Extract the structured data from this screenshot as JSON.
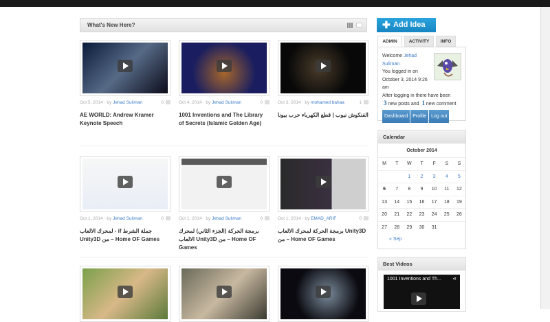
{
  "header": {
    "title": "What's New Here?"
  },
  "posts": [
    {
      "date": "Oct 5, 2014",
      "by": "by",
      "author": "Jehad Suliman",
      "comments": "0",
      "title": "AE WORLD: Andrew Kramer Keynote Speech",
      "bg": "linear-gradient(135deg,#0a1a3a,#566a86 50%,#0b0b1a)"
    },
    {
      "date": "Oct 4, 2014",
      "by": "by",
      "author": "Jehad Suliman",
      "comments": "0",
      "title": "1001 Inventions and The Library of Secrets (Islamic Golden Age)",
      "bg": "radial-gradient(circle at 50% 60%,#a7662a,#1a1e60 60%)"
    },
    {
      "date": "Oct 3, 2014",
      "by": "by",
      "author": "mohamed bahaa",
      "comments": "1",
      "title": "الفنكوش نيوب | قطع الكهرباء حرب بيونا",
      "bg": "radial-gradient(circle at 45% 50%,#4a3c2a,#080808 60%)"
    },
    {
      "date": "Oct 1, 2014",
      "by": "by",
      "author": "Jehad Suliman",
      "comments": "0",
      "title": "لمحرك الالعاب - if جملة الشرط Unity3D من – Home OF Games",
      "bg": "linear-gradient(#f6f6f6,#e9eef6)"
    },
    {
      "date": "Oct 1, 2014",
      "by": "by",
      "author": "Jehad Suliman",
      "comments": "0",
      "title": "برمجة الحركة (الجزء الثاني) لمحرك الالعاب Unity3D من – Home OF Games",
      "bg": "linear-gradient(#5a5a5a 0 12%,#f2f2f2 12%)"
    },
    {
      "date": "Oct 1, 2014",
      "by": "by",
      "author": "EMAD_ARIF",
      "comments": "0",
      "title": "برمجة الحركة لمحرك الالعاب Unity3D من – Home OF Games",
      "bg": "linear-gradient(90deg,#2a2a2a,#3a3040 60%,#cfcfcf 60%)"
    },
    {
      "bg": "linear-gradient(135deg,#7aa04a,#d8b888 50%,#5a7a3a)"
    },
    {
      "bg": "linear-gradient(135deg,#6a6a5a,#c8b8a0 50%,#3a3a30)"
    },
    {
      "bg": "radial-gradient(circle at 55% 50%,#7a8a9a,#0a0a10 60%)"
    }
  ],
  "sidebar": {
    "add_idea": "Add Idea",
    "tabs": [
      "ADMIN",
      "ACTIVITY",
      "INFO"
    ],
    "welcome": "Welcome",
    "user": "Jehad Suliman",
    "logged": "You logged in on October 3, 2014 9:26 am",
    "after": "After logging in there have been",
    "posts_count": "3",
    "posts_text": "new posts and",
    "comments_count": "1",
    "comments_text": "new comment",
    "buttons": [
      "Dashboard",
      "Profile",
      "Log out"
    ],
    "calendar_title": "Calendar",
    "month": "October 2014",
    "days": [
      "M",
      "T",
      "W",
      "T",
      "F",
      "S",
      "S"
    ],
    "weeks": [
      [
        "",
        "",
        "1",
        "2",
        "3",
        "4",
        "5"
      ],
      [
        "6",
        "7",
        "8",
        "9",
        "10",
        "11",
        "12"
      ],
      [
        "13",
        "14",
        "15",
        "16",
        "17",
        "18",
        "19"
      ],
      [
        "20",
        "21",
        "22",
        "23",
        "24",
        "25",
        "26"
      ],
      [
        "27",
        "28",
        "29",
        "30",
        "31",
        "",
        ""
      ]
    ],
    "linked": [
      "1",
      "2",
      "3",
      "4",
      "5"
    ],
    "today": "6",
    "prev": "« Sep",
    "best_videos": "Best Videos",
    "video_title": "1001 Inventions and Th..."
  }
}
